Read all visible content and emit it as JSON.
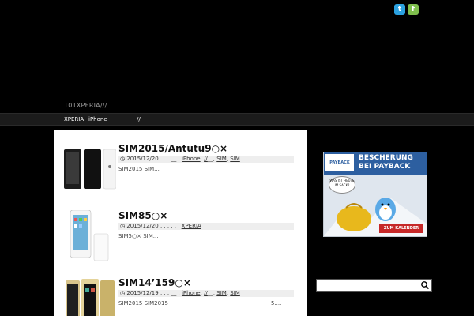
{
  "header": {
    "social": {
      "twitter_icon": "t",
      "feedly_icon": "f"
    },
    "site_title": "101XPERIA///"
  },
  "nav": {
    "items": [
      {
        "label": "XPERIA"
      },
      {
        "label": "iPhone"
      },
      {
        "label": "//"
      }
    ]
  },
  "posts": [
    {
      "title": "SIM2015/Antutu9○×",
      "date": "2015/12/20",
      "categories_prefix": ". . . __ ,",
      "cat1": "iPhone",
      "cat2": "//",
      "cat2_suffix": "__",
      "cat3": "SIM",
      "cat4": "SIM",
      "excerpt": "SIM2015 SIM..."
    },
    {
      "title": "SIM85○×",
      "date": "2015/12/20",
      "categories_prefix": ". . . . . .",
      "cat1": "XPERIA",
      "excerpt": "SIM5○× SIM..."
    },
    {
      "title": "SIM14’159○×",
      "date": "2015/12/19",
      "categories_prefix": ". . . __ ,",
      "cat1": "iPhone",
      "cat2": "//",
      "cat2_suffix": "__",
      "cat3": "SIM",
      "cat4": "SIM",
      "excerpt": "SIM2015 SIM2015",
      "excerpt_right": "5...."
    }
  ],
  "ad": {
    "logo": "PAYBACK",
    "headline1": "BESCHERUNG",
    "headline2": "BEI PAYBACK",
    "bubble": "WAS IST HEUTE IM SACK?",
    "button": "ZUM KALENDER"
  },
  "search": {
    "placeholder": ""
  },
  "colors": {
    "twitter": "#2ba1e0",
    "feedly": "#7fbf4d",
    "ad_blue": "#2d5fa0",
    "ad_red": "#c62828"
  }
}
